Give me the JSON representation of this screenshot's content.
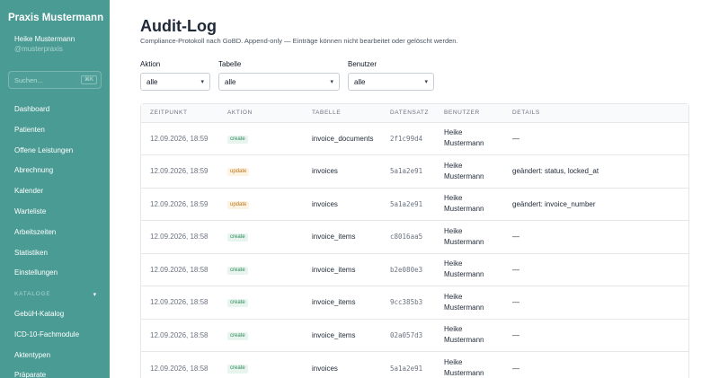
{
  "sidebar": {
    "brand": "Praxis Mustermann",
    "user_name": "Heike Mustermann",
    "user_handle": "@musterpraxis",
    "search_placeholder": "Suchen...",
    "search_shortcut": "⌘K",
    "nav_items": [
      "Dashboard",
      "Patienten",
      "Offene Leistungen",
      "Abrechnung",
      "Kalender",
      "Warteliste",
      "Arbeitszeiten",
      "Statistiken",
      "Einstellungen"
    ],
    "section_label": "KATALOGE",
    "catalog_items": [
      "GebüH-Katalog",
      "ICD-10-Fachmodule",
      "Aktentypen",
      "Präparate"
    ]
  },
  "page": {
    "title": "Audit-Log",
    "subtitle": "Compliance-Protokoll nach GoBD. Append-only — Einträge können nicht bearbeitet oder gelöscht werden."
  },
  "filters": {
    "action_label": "Aktion",
    "action_value": "alle",
    "table_label": "Tabelle",
    "table_value": "alle",
    "user_label": "Benutzer",
    "user_value": "alle"
  },
  "table": {
    "headers": [
      "ZEITPUNKT",
      "AKTION",
      "TABELLE",
      "DATENSATZ",
      "BENUTZER",
      "DETAILS"
    ],
    "rows": [
      {
        "time": "12.09.2026, 18:59",
        "action": "create",
        "table": "invoice_documents",
        "record": "2f1c99d4",
        "user": "Heike Mustermann",
        "details": "—"
      },
      {
        "time": "12.09.2026, 18:59",
        "action": "update",
        "table": "invoices",
        "record": "5a1a2e91",
        "user": "Heike Mustermann",
        "details": "geändert: status, locked_at"
      },
      {
        "time": "12.09.2026, 18:59",
        "action": "update",
        "table": "invoices",
        "record": "5a1a2e91",
        "user": "Heike Mustermann",
        "details": "geändert: invoice_number"
      },
      {
        "time": "12.09.2026, 18:58",
        "action": "create",
        "table": "invoice_items",
        "record": "c8016aa5",
        "user": "Heike Mustermann",
        "details": "—"
      },
      {
        "time": "12.09.2026, 18:58",
        "action": "create",
        "table": "invoice_items",
        "record": "b2e080e3",
        "user": "Heike Mustermann",
        "details": "—"
      },
      {
        "time": "12.09.2026, 18:58",
        "action": "create",
        "table": "invoice_items",
        "record": "9cc385b3",
        "user": "Heike Mustermann",
        "details": "—"
      },
      {
        "time": "12.09.2026, 18:58",
        "action": "create",
        "table": "invoice_items",
        "record": "02a057d3",
        "user": "Heike Mustermann",
        "details": "—"
      },
      {
        "time": "12.09.2026, 18:58",
        "action": "create",
        "table": "invoices",
        "record": "5a1a2e91",
        "user": "Heike Mustermann",
        "details": "—"
      }
    ]
  }
}
